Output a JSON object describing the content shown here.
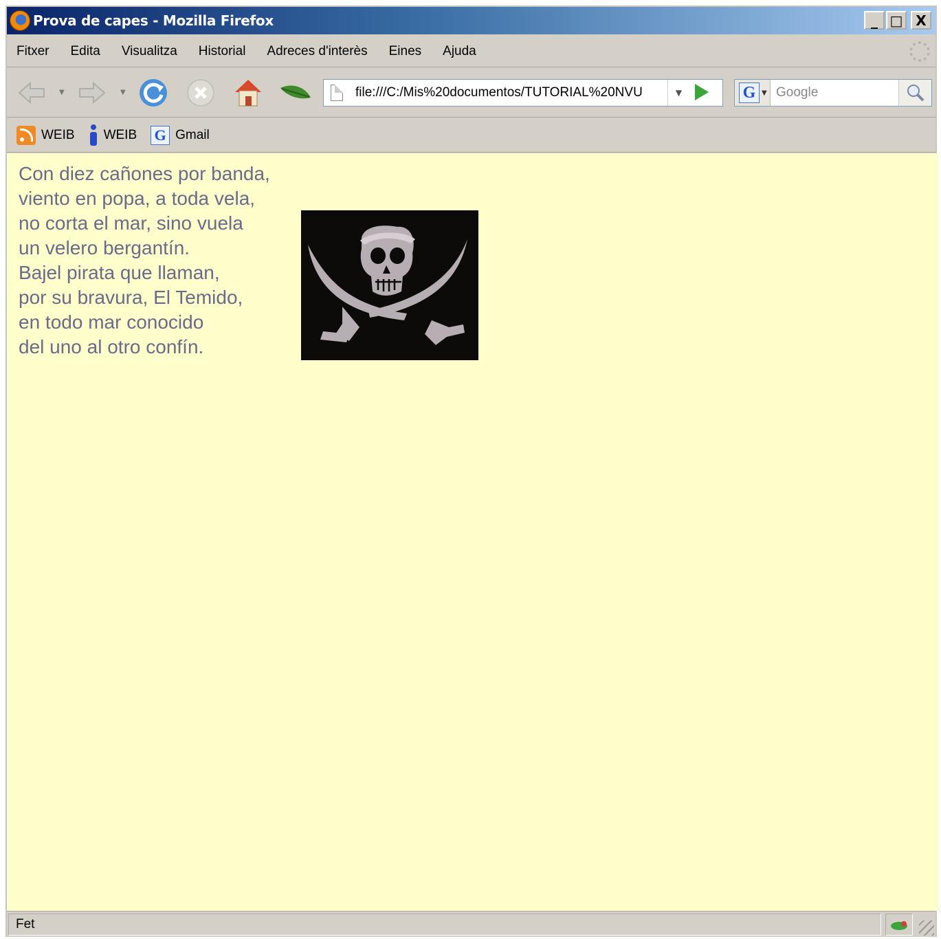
{
  "window": {
    "title": "Prova de capes - Mozilla Firefox",
    "controls": {
      "minimize": "_",
      "maximize": "□",
      "close": "X"
    }
  },
  "menu": {
    "items": [
      {
        "label": "Fitxer"
      },
      {
        "label": "Edita"
      },
      {
        "label": "Visualitza"
      },
      {
        "label": "Historial"
      },
      {
        "label": "Adreces d'interès"
      },
      {
        "label": "Eines"
      },
      {
        "label": "Ajuda"
      }
    ]
  },
  "navbar": {
    "icons": [
      "back-icon",
      "forward-icon",
      "reload-icon",
      "stop-icon",
      "home-icon",
      "leaf-icon",
      "go-icon"
    ],
    "url": "file:///C:/Mis%20documentos/TUTORIAL%20NVU",
    "search_placeholder": "Google",
    "search_engine": "G"
  },
  "bookmarks": [
    {
      "label": "WEIB",
      "icon": "rss-icon"
    },
    {
      "label": "WEIB",
      "icon": "info-icon"
    },
    {
      "label": "Gmail",
      "icon": "google-icon"
    }
  ],
  "content": {
    "background": "#ffffcc",
    "poem_lines": [
      "Con diez cañones por banda,",
      "viento en popa, a toda vela,",
      "no corta el mar, sino vuela",
      "un velero bergantín.",
      "Bajel pirata que llaman,",
      "por su bravura, El Temido,",
      "en todo mar conocido",
      "del uno al otro confín."
    ],
    "image": "pirate-flag-icon"
  },
  "status": {
    "text": "Fet"
  }
}
